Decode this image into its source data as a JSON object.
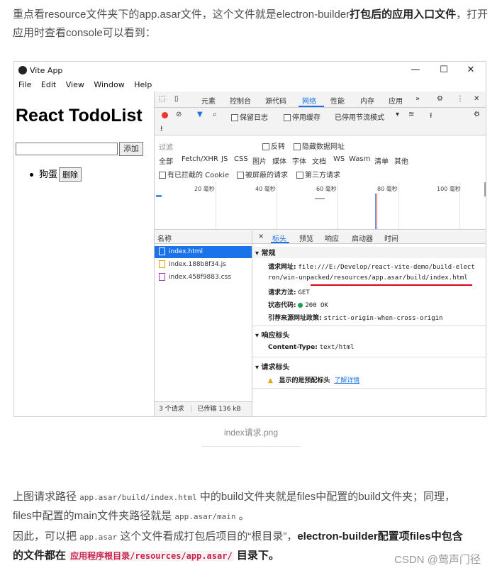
{
  "intro": {
    "part1": "重点看resource文件夹下的app.asar文件，这个文件就是electron-builder",
    "bold1": "打包后的应用入口文件",
    "part2": "，打开应用时查看console可以看到："
  },
  "window": {
    "title": "Vite App",
    "controls": {
      "minimize": "—",
      "maximize": "☐",
      "close": "✕"
    },
    "menu": [
      "File",
      "Edit",
      "View",
      "Window",
      "Help"
    ]
  },
  "app": {
    "heading": "React TodoList",
    "add_button": "添加",
    "todo_item": "狗蛋",
    "delete_button": "删除"
  },
  "devtools": {
    "tabs": [
      "元素",
      "控制台",
      "源代码",
      "网络",
      "性能",
      "内存",
      "应用",
      "»"
    ],
    "active_tab": "网络",
    "toolbar": {
      "preserve_log": "保留日志",
      "disable_cache": "停用缓存",
      "throttling": "已停用节流模式"
    },
    "filter": {
      "placeholder": "过滤",
      "invert": "反转",
      "hide_data_urls": "隐藏数据网址",
      "types": [
        "全部",
        "Fetch/XHR",
        "JS",
        "CSS",
        "图片",
        "媒体",
        "字体",
        "文档",
        "WS",
        "Wasm",
        "清单",
        "其他"
      ],
      "blocked_cookies": "有已拦截的 Cookie",
      "blocked_requests": "被屏蔽的请求",
      "third_party": "第三方请求"
    },
    "timeline_labels": [
      "20 毫秒",
      "40 毫秒",
      "60 毫秒",
      "80 毫秒",
      "100 毫秒"
    ],
    "list_header": "名称",
    "requests": [
      {
        "name": "index.html",
        "selected": true
      },
      {
        "name": "index.188b8f34.js",
        "selected": false
      },
      {
        "name": "index.458f9883.css",
        "selected": false
      }
    ],
    "footer": {
      "count": "3 个请求",
      "transferred": "已传输 136 kB"
    },
    "detail_tabs": [
      "×",
      "标头",
      "预览",
      "响应",
      "启动器",
      "时间"
    ],
    "general": {
      "title": "▾ 常规",
      "url_label": "请求网址:",
      "url_line1": "file:///E:/Develop/react-vite-demo/build-elect",
      "url_line2": "ron/win-unpacked/resources/app.asar/build/index.html",
      "method_label": "请求方法:",
      "method": "GET",
      "status_label": "状态代码:",
      "status": "200 OK",
      "referrer_label": "引荐来源网址政策:",
      "referrer": "strict-origin-when-cross-origin"
    },
    "response_headers": {
      "title": "▾ 响应标头",
      "content_type_label": "Content-Type:",
      "content_type": "text/html"
    },
    "request_headers": {
      "title": "▾ 请求标头",
      "warning": "显示的是预配标头",
      "learn_more": "了解详情"
    }
  },
  "caption": "index请求.png",
  "para2": {
    "t1": "上图请求路径 ",
    "c1": "app.asar/build/index.html",
    "t2": " 中的build文件夹就是files中配置的build文件夹；同理，",
    "t3": "files中配置的main文件夹路径就是 ",
    "c2": "app.asar/main",
    "t4": " 。"
  },
  "para3": {
    "t1": "因此，可以把 ",
    "c1": "app.asar",
    "t2": " 这个文件看成打包后项目的“根目录”，",
    "b1": "electron-builder配置项files中包含",
    "b2": "的文件都在 ",
    "c2": "应用程序根目录/resources/app.asar/",
    "b3": " 目录下。"
  },
  "watermark": "CSDN @莺声门径",
  "colors": {
    "accent": "#1a73e8",
    "warning_red": "#d01",
    "code_red": "#c7254e"
  }
}
